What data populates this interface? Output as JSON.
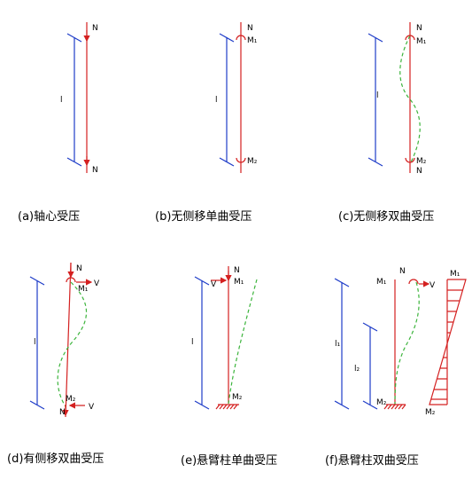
{
  "panels": [
    {
      "caption": "(a)轴心受压",
      "labels": {
        "n_top": "N",
        "n_bot": "N",
        "len": "l"
      }
    },
    {
      "caption": "(b)无侧移单曲受压",
      "labels": {
        "n_top": "N",
        "m_top": "M₁",
        "m_bot": "M₂",
        "len": "l"
      }
    },
    {
      "caption": "(c)无侧移双曲受压",
      "labels": {
        "n_top": "N",
        "m_top": "M₁",
        "m_bot": "M₂",
        "n_bot": "N",
        "len": "l"
      }
    },
    {
      "caption": "(d)有侧移双曲受压",
      "labels": {
        "n_top": "N",
        "m_top": "M₁",
        "v_top": "V",
        "m_bot": "M₂",
        "n_bot": "N",
        "v_bot": "V",
        "len": "l"
      }
    },
    {
      "caption": "(e)悬臂柱单曲受压",
      "labels": {
        "n_top": "N",
        "m_top": "M₁",
        "v_top": "V",
        "m_bot": "M₂",
        "len": "l"
      }
    },
    {
      "caption": "(f)悬臂柱双曲受压",
      "labels": {
        "n_top": "N",
        "m_top": "M₁",
        "v_top": "V",
        "m_bot": "M₂",
        "m_right": "M₁",
        "m_right_bot": "M₂",
        "l1": "l₁",
        "l2": "l₂"
      }
    }
  ],
  "colors": {
    "dimension": "#1e3cc8",
    "column": "#d42020",
    "deflection": "#3cb43c"
  }
}
